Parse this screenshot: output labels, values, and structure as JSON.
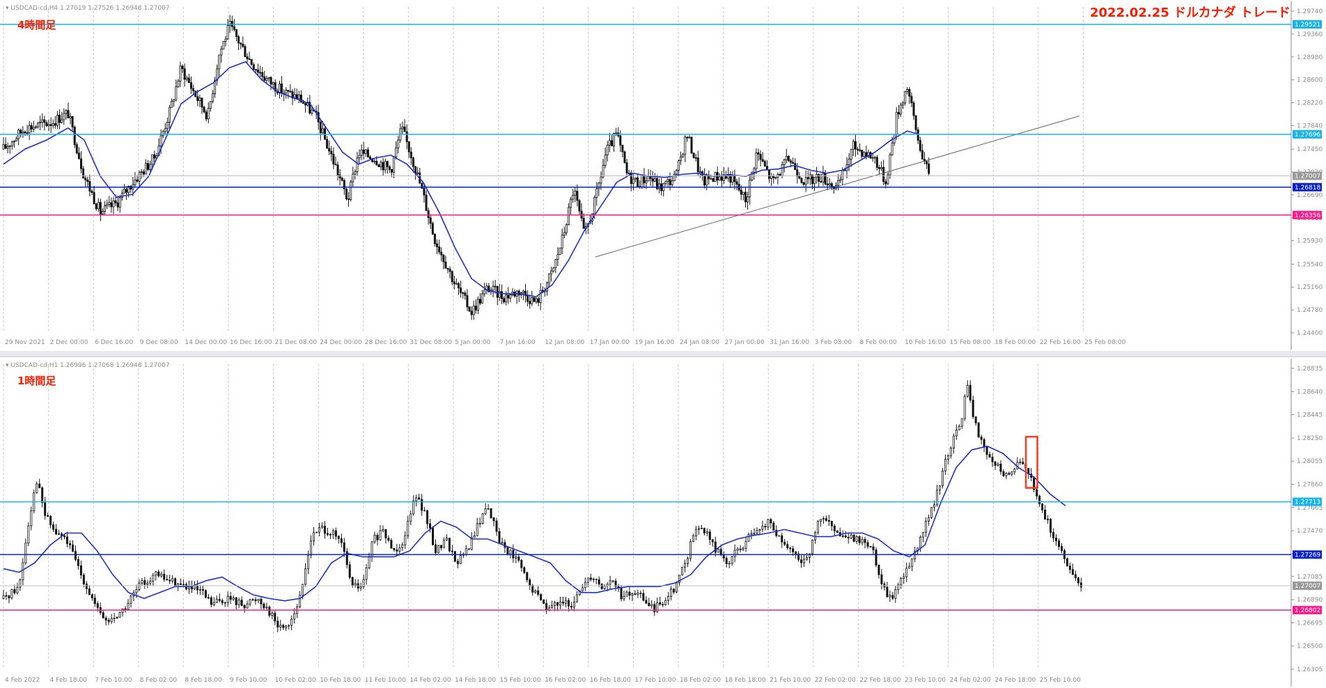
{
  "page": {
    "title": "2022.02.25 ドルカナダ トレード"
  },
  "colors": {
    "cyan": "#16b4ea",
    "blue": "#0b22c8",
    "magenta": "#ff1a8c",
    "gray": "#9a9a9a",
    "ma": "#1c2fd0",
    "candle": "#111111",
    "trend": "#666666",
    "box": "#ff3a1a"
  },
  "chart_data": [
    {
      "type": "candlestick",
      "title": "4時間足",
      "symbol_header": "USDCAD-cd,H4  1.27019 1.27526 1.26948 1.27007",
      "y_ticks": [
        "1.29740",
        "1.29360",
        "1.28980",
        "1.28600",
        "1.28220",
        "1.27840",
        "1.27450",
        "1.27070",
        "1.26690",
        "1.26310",
        "1.25930",
        "1.25540",
        "1.25160",
        "1.24780",
        "1.24400"
      ],
      "ylim": [
        1.244,
        1.2974
      ],
      "x_ticks": [
        "29 Nov 2021",
        "2 Dec 00:00",
        "6 Dec 16:00",
        "9 Dec 08:00",
        "14 Dec 00:00",
        "16 Dec 16:00",
        "21 Dec 08:00",
        "24 Dec 00:00",
        "28 Dec 16:00",
        "31 Dec 08:00",
        "5 Jan 00:00",
        "7 Jan 16:00",
        "12 Jan 08:00",
        "17 Jan 00:00",
        "19 Jan 16:00",
        "24 Jan 08:00",
        "27 Jan 00:00",
        "31 Jan 16:00",
        "3 Feb 08:00",
        "8 Feb 00:00",
        "10 Feb 16:00",
        "15 Feb 08:00",
        "18 Feb 00:00",
        "22 Feb 16:00",
        "25 Feb 08:00"
      ],
      "levels": [
        {
          "value": 1.29521,
          "label": "1.29521",
          "color": "cyan"
        },
        {
          "value": 1.27696,
          "label": "1.27696",
          "color": "cyan"
        },
        {
          "value": 1.26818,
          "label": "1.26818",
          "color": "blue"
        },
        {
          "value": 1.26356,
          "label": "1.26356",
          "color": "magenta"
        }
      ],
      "current_price": {
        "value": 1.27007,
        "label": "1.27007"
      },
      "price_path": [
        [
          0,
          1.2745
        ],
        [
          0.02,
          1.278
        ],
        [
          0.045,
          1.279
        ],
        [
          0.06,
          1.2805
        ],
        [
          0.075,
          1.27
        ],
        [
          0.09,
          1.264
        ],
        [
          0.105,
          1.2655
        ],
        [
          0.12,
          1.269
        ],
        [
          0.14,
          1.273
        ],
        [
          0.155,
          1.281
        ],
        [
          0.165,
          1.288
        ],
        [
          0.18,
          1.283
        ],
        [
          0.19,
          1.28
        ],
        [
          0.2,
          1.29
        ],
        [
          0.21,
          1.295
        ],
        [
          0.22,
          1.292
        ],
        [
          0.23,
          1.289
        ],
        [
          0.245,
          1.286
        ],
        [
          0.26,
          1.284
        ],
        [
          0.275,
          1.283
        ],
        [
          0.29,
          1.28
        ],
        [
          0.31,
          1.271
        ],
        [
          0.32,
          1.266
        ],
        [
          0.33,
          1.274
        ],
        [
          0.345,
          1.273
        ],
        [
          0.36,
          1.271
        ],
        [
          0.37,
          1.278
        ],
        [
          0.38,
          1.273
        ],
        [
          0.39,
          1.267
        ],
        [
          0.4,
          1.26
        ],
        [
          0.41,
          1.256
        ],
        [
          0.42,
          1.252
        ],
        [
          0.435,
          1.2475
        ],
        [
          0.45,
          1.2515
        ],
        [
          0.465,
          1.25
        ],
        [
          0.48,
          1.251
        ],
        [
          0.495,
          1.249
        ],
        [
          0.51,
          1.254
        ],
        [
          0.52,
          1.26
        ],
        [
          0.53,
          1.268
        ],
        [
          0.54,
          1.26
        ],
        [
          0.55,
          1.266
        ],
        [
          0.56,
          1.274
        ],
        [
          0.57,
          1.277
        ],
        [
          0.58,
          1.27
        ],
        [
          0.59,
          1.269
        ],
        [
          0.6,
          1.27
        ],
        [
          0.61,
          1.268
        ],
        [
          0.625,
          1.27
        ],
        [
          0.635,
          1.277
        ],
        [
          0.65,
          1.269
        ],
        [
          0.66,
          1.27
        ],
        [
          0.675,
          1.27
        ],
        [
          0.69,
          1.266
        ],
        [
          0.7,
          1.274
        ],
        [
          0.715,
          1.269
        ],
        [
          0.73,
          1.273
        ],
        [
          0.745,
          1.269
        ],
        [
          0.76,
          1.27
        ],
        [
          0.775,
          1.268
        ],
        [
          0.79,
          1.275
        ],
        [
          0.81,
          1.273
        ],
        [
          0.82,
          1.269
        ],
        [
          0.83,
          1.28
        ],
        [
          0.84,
          1.285
        ],
        [
          0.85,
          1.276
        ],
        [
          0.86,
          1.27
        ]
      ],
      "ma_path": [
        [
          0,
          1.272
        ],
        [
          0.02,
          1.2745
        ],
        [
          0.04,
          1.276
        ],
        [
          0.06,
          1.278
        ],
        [
          0.075,
          1.276
        ],
        [
          0.09,
          1.27
        ],
        [
          0.105,
          1.2665
        ],
        [
          0.12,
          1.267
        ],
        [
          0.135,
          1.27
        ],
        [
          0.15,
          1.276
        ],
        [
          0.165,
          1.282
        ],
        [
          0.18,
          1.284
        ],
        [
          0.195,
          1.2855
        ],
        [
          0.21,
          1.288
        ],
        [
          0.225,
          1.289
        ],
        [
          0.24,
          1.286
        ],
        [
          0.255,
          1.284
        ],
        [
          0.27,
          1.283
        ],
        [
          0.285,
          1.282
        ],
        [
          0.3,
          1.278
        ],
        [
          0.315,
          1.274
        ],
        [
          0.33,
          1.272
        ],
        [
          0.345,
          1.273
        ],
        [
          0.36,
          1.2735
        ],
        [
          0.375,
          1.272
        ],
        [
          0.39,
          1.269
        ],
        [
          0.405,
          1.264
        ],
        [
          0.42,
          1.258
        ],
        [
          0.435,
          1.253
        ],
        [
          0.45,
          1.251
        ],
        [
          0.465,
          1.2505
        ],
        [
          0.48,
          1.2505
        ],
        [
          0.495,
          1.25
        ],
        [
          0.51,
          1.252
        ],
        [
          0.525,
          1.256
        ],
        [
          0.54,
          1.261
        ],
        [
          0.555,
          1.265
        ],
        [
          0.57,
          1.269
        ],
        [
          0.585,
          1.2705
        ],
        [
          0.6,
          1.27
        ],
        [
          0.615,
          1.2698
        ],
        [
          0.63,
          1.2703
        ],
        [
          0.645,
          1.2705
        ],
        [
          0.66,
          1.27
        ],
        [
          0.675,
          1.2702
        ],
        [
          0.69,
          1.27
        ],
        [
          0.705,
          1.271
        ],
        [
          0.72,
          1.2712
        ],
        [
          0.735,
          1.2718
        ],
        [
          0.75,
          1.271
        ],
        [
          0.765,
          1.2705
        ],
        [
          0.78,
          1.271
        ],
        [
          0.795,
          1.2725
        ],
        [
          0.81,
          1.274
        ],
        [
          0.825,
          1.276
        ],
        [
          0.84,
          1.2775
        ],
        [
          0.85,
          1.277
        ]
      ],
      "trendline": [
        [
          0.55,
          1.2566
        ],
        [
          1.0,
          1.28
        ]
      ]
    },
    {
      "type": "candlestick",
      "title": "1時間足",
      "symbol_header": "USDCAD-cd,H1  1.26996 1.27068 1.26948 1.27007",
      "y_ticks": [
        "1.28835",
        "1.28640",
        "1.28445",
        "1.28250",
        "1.28055",
        "1.27860",
        "1.27665",
        "1.27470",
        "1.27275",
        "1.27085",
        "1.26890",
        "1.26695",
        "1.26500",
        "1.26305"
      ],
      "ylim": [
        1.26305,
        1.28835
      ],
      "x_ticks": [
        "4 Feb 2022",
        "4 Feb 18:00",
        "7 Feb 10:00",
        "8 Feb 02:00",
        "8 Feb 18:00",
        "9 Feb 10:00",
        "10 Feb 02:00",
        "10 Feb 18:00",
        "11 Feb 10:00",
        "14 Feb 02:00",
        "14 Feb 18:00",
        "15 Feb 10:00",
        "16 Feb 02:00",
        "16 Feb 18:00",
        "17 Feb 10:00",
        "18 Feb 02:00",
        "18 Feb 18:00",
        "21 Feb 10:00",
        "22 Feb 02:00",
        "22 Feb 18:00",
        "23 Feb 10:00",
        "24 Feb 02:00",
        "24 Feb 18:00",
        "25 Feb 10:00"
      ],
      "levels": [
        {
          "value": 1.27713,
          "label": "1.27713",
          "color": "cyan"
        },
        {
          "value": 1.27269,
          "label": "1.27269",
          "color": "blue"
        },
        {
          "value": 1.26802,
          "label": "1.26802",
          "color": "magenta"
        }
      ],
      "current_price": {
        "value": 1.27007,
        "label": "1.27007"
      },
      "price_path": [
        [
          0,
          1.269
        ],
        [
          0.015,
          1.27
        ],
        [
          0.025,
          1.276
        ],
        [
          0.032,
          1.279
        ],
        [
          0.04,
          1.276
        ],
        [
          0.05,
          1.2745
        ],
        [
          0.06,
          1.274
        ],
        [
          0.07,
          1.272
        ],
        [
          0.08,
          1.27
        ],
        [
          0.09,
          1.268
        ],
        [
          0.1,
          1.267
        ],
        [
          0.115,
          1.268
        ],
        [
          0.13,
          1.27
        ],
        [
          0.145,
          1.271
        ],
        [
          0.16,
          1.2705
        ],
        [
          0.175,
          1.27
        ],
        [
          0.19,
          1.2695
        ],
        [
          0.2,
          1.2685
        ],
        [
          0.215,
          1.269
        ],
        [
          0.23,
          1.2685
        ],
        [
          0.245,
          1.269
        ],
        [
          0.255,
          1.268
        ],
        [
          0.265,
          1.2665
        ],
        [
          0.275,
          1.267
        ],
        [
          0.285,
          1.269
        ],
        [
          0.295,
          1.274
        ],
        [
          0.305,
          1.275
        ],
        [
          0.315,
          1.2745
        ],
        [
          0.325,
          1.2735
        ],
        [
          0.335,
          1.27
        ],
        [
          0.345,
          1.27
        ],
        [
          0.355,
          1.274
        ],
        [
          0.365,
          1.2745
        ],
        [
          0.375,
          1.273
        ],
        [
          0.385,
          1.274
        ],
        [
          0.395,
          1.278
        ],
        [
          0.405,
          1.276
        ],
        [
          0.415,
          1.273
        ],
        [
          0.425,
          1.274
        ],
        [
          0.435,
          1.272
        ],
        [
          0.445,
          1.273
        ],
        [
          0.455,
          1.275
        ],
        [
          0.465,
          1.277
        ],
        [
          0.475,
          1.274
        ],
        [
          0.485,
          1.273
        ],
        [
          0.495,
          1.272
        ],
        [
          0.505,
          1.27
        ],
        [
          0.515,
          1.269
        ],
        [
          0.525,
          1.268
        ],
        [
          0.535,
          1.269
        ],
        [
          0.545,
          1.268
        ],
        [
          0.555,
          1.27
        ],
        [
          0.565,
          1.271
        ],
        [
          0.575,
          1.27
        ],
        [
          0.585,
          1.2705
        ],
        [
          0.595,
          1.269
        ],
        [
          0.605,
          1.2695
        ],
        [
          0.615,
          1.269
        ],
        [
          0.625,
          1.268
        ],
        [
          0.635,
          1.269
        ],
        [
          0.645,
          1.27
        ],
        [
          0.655,
          1.272
        ],
        [
          0.665,
          1.275
        ],
        [
          0.675,
          1.2745
        ],
        [
          0.685,
          1.273
        ],
        [
          0.695,
          1.272
        ],
        [
          0.705,
          1.273
        ],
        [
          0.715,
          1.274
        ],
        [
          0.725,
          1.2745
        ],
        [
          0.735,
          1.2755
        ],
        [
          0.745,
          1.274
        ],
        [
          0.755,
          1.273
        ],
        [
          0.765,
          1.272
        ],
        [
          0.775,
          1.273
        ],
        [
          0.785,
          1.276
        ],
        [
          0.795,
          1.275
        ],
        [
          0.805,
          1.274
        ],
        [
          0.815,
          1.274
        ],
        [
          0.825,
          1.274
        ],
        [
          0.835,
          1.273
        ],
        [
          0.845,
          1.27
        ],
        [
          0.852,
          1.269
        ],
        [
          0.86,
          1.27
        ],
        [
          0.87,
          1.272
        ],
        [
          0.88,
          1.274
        ],
        [
          0.89,
          1.276
        ],
        [
          0.9,
          1.279
        ],
        [
          0.91,
          1.282
        ],
        [
          0.92,
          1.284
        ],
        [
          0.925,
          1.287
        ],
        [
          0.93,
          1.285
        ],
        [
          0.935,
          1.283
        ],
        [
          0.945,
          1.281
        ],
        [
          0.955,
          1.28
        ],
        [
          0.965,
          1.279
        ],
        [
          0.975,
          1.281
        ],
        [
          0.983,
          1.28
        ],
        [
          0.99,
          1.278
        ],
        [
          1.0,
          1.276
        ],
        [
          1.01,
          1.274
        ],
        [
          1.02,
          1.272
        ],
        [
          1.03,
          1.2705
        ],
        [
          1.035,
          1.27
        ]
      ],
      "ma_path": [
        [
          0,
          1.2715
        ],
        [
          0.015,
          1.2712
        ],
        [
          0.03,
          1.272
        ],
        [
          0.045,
          1.2735
        ],
        [
          0.06,
          1.2745
        ],
        [
          0.075,
          1.2745
        ],
        [
          0.09,
          1.273
        ],
        [
          0.105,
          1.271
        ],
        [
          0.12,
          1.2695
        ],
        [
          0.135,
          1.269
        ],
        [
          0.15,
          1.2695
        ],
        [
          0.165,
          1.27
        ],
        [
          0.18,
          1.27
        ],
        [
          0.195,
          1.2705
        ],
        [
          0.21,
          1.2708
        ],
        [
          0.225,
          1.27
        ],
        [
          0.24,
          1.2693
        ],
        [
          0.255,
          1.269
        ],
        [
          0.27,
          1.2688
        ],
        [
          0.285,
          1.269
        ],
        [
          0.3,
          1.27
        ],
        [
          0.315,
          1.272
        ],
        [
          0.33,
          1.2728
        ],
        [
          0.345,
          1.2725
        ],
        [
          0.36,
          1.2725
        ],
        [
          0.375,
          1.2725
        ],
        [
          0.39,
          1.273
        ],
        [
          0.405,
          1.2745
        ],
        [
          0.42,
          1.2755
        ],
        [
          0.435,
          1.275
        ],
        [
          0.45,
          1.274
        ],
        [
          0.465,
          1.274
        ],
        [
          0.48,
          1.2735
        ],
        [
          0.495,
          1.273
        ],
        [
          0.51,
          1.2725
        ],
        [
          0.525,
          1.272
        ],
        [
          0.54,
          1.2705
        ],
        [
          0.555,
          1.2695
        ],
        [
          0.57,
          1.2695
        ],
        [
          0.585,
          1.2698
        ],
        [
          0.6,
          1.27
        ],
        [
          0.615,
          1.27
        ],
        [
          0.63,
          1.27
        ],
        [
          0.645,
          1.2703
        ],
        [
          0.66,
          1.271
        ],
        [
          0.675,
          1.2725
        ],
        [
          0.69,
          1.2735
        ],
        [
          0.705,
          1.274
        ],
        [
          0.72,
          1.2743
        ],
        [
          0.735,
          1.2745
        ],
        [
          0.75,
          1.2748
        ],
        [
          0.765,
          1.2745
        ],
        [
          0.78,
          1.2742
        ],
        [
          0.795,
          1.2742
        ],
        [
          0.81,
          1.2745
        ],
        [
          0.825,
          1.2745
        ],
        [
          0.84,
          1.274
        ],
        [
          0.855,
          1.273
        ],
        [
          0.87,
          1.2725
        ],
        [
          0.885,
          1.2735
        ],
        [
          0.9,
          1.277
        ],
        [
          0.915,
          1.28
        ],
        [
          0.93,
          1.2815
        ],
        [
          0.945,
          1.2818
        ],
        [
          0.96,
          1.2812
        ],
        [
          0.975,
          1.28
        ],
        [
          0.99,
          1.2792
        ],
        [
          1.005,
          1.2778
        ],
        [
          1.02,
          1.2768
        ]
      ],
      "box": {
        "x0": 0.982,
        "x1": 0.993,
        "y0": 1.2826,
        "y1": 1.2783
      }
    }
  ]
}
